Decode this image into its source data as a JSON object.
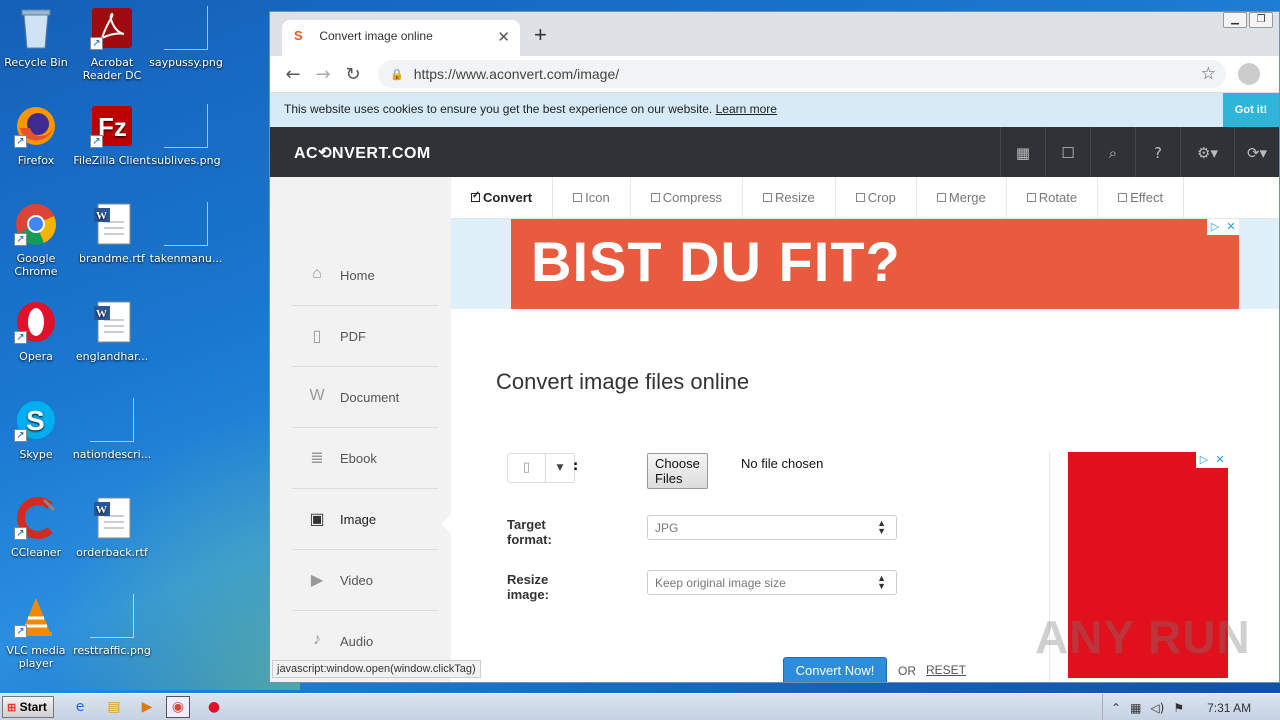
{
  "desktop": {
    "icons": [
      {
        "label": "Recycle Bin",
        "icon": "recycle-bin-icon"
      },
      {
        "label": "Acrobat Reader DC",
        "icon": "acrobat-icon"
      },
      {
        "label": "saypussy.png",
        "icon": "png-file-icon"
      },
      {
        "label": "Firefox",
        "icon": "firefox-icon"
      },
      {
        "label": "FileZilla Client",
        "icon": "filezilla-icon"
      },
      {
        "label": "sublives.png",
        "icon": "png-file-icon"
      },
      {
        "label": "Google Chrome",
        "icon": "chrome-icon"
      },
      {
        "label": "brandme.rtf",
        "icon": "word-doc-icon"
      },
      {
        "label": "takenmanu...",
        "icon": "file-icon"
      },
      {
        "label": "Opera",
        "icon": "opera-icon"
      },
      {
        "label": "englandhar...",
        "icon": "word-doc-icon"
      },
      {
        "label": "Skype",
        "icon": "skype-icon"
      },
      {
        "label": "nationdescri...",
        "icon": "file-icon"
      },
      {
        "label": "CCleaner",
        "icon": "ccleaner-icon"
      },
      {
        "label": "orderback.rtf",
        "icon": "word-doc-icon"
      },
      {
        "label": "VLC media player",
        "icon": "vlc-icon"
      },
      {
        "label": "resttraffic.png",
        "icon": "png-file-icon"
      }
    ]
  },
  "browser": {
    "tab_title": "Convert image online",
    "url": "https://www.aconvert.com/image/",
    "cookie_text": "This website uses cookies to ensure you get the best experience on our website.",
    "cookie_link": "Learn more",
    "cookie_button": "Got it!",
    "status_text": "javascript:window.open(window.clickTag)"
  },
  "site": {
    "logo": "AC⟲NVERT.COM",
    "sidebar": [
      {
        "label": "Home",
        "icon": "home-icon"
      },
      {
        "label": "PDF",
        "icon": "pdf-icon"
      },
      {
        "label": "Document",
        "icon": "document-icon"
      },
      {
        "label": "Ebook",
        "icon": "ebook-icon"
      },
      {
        "label": "Image",
        "icon": "image-icon"
      },
      {
        "label": "Video",
        "icon": "video-icon"
      },
      {
        "label": "Audio",
        "icon": "audio-icon"
      }
    ],
    "tabs": [
      "Convert",
      "Icon",
      "Compress",
      "Resize",
      "Crop",
      "Merge",
      "Rotate",
      "Effect"
    ],
    "ad_text": "BIST DU FIT?",
    "page_title": "Convert image files online",
    "form": {
      "choose_button": "Choose Files",
      "no_file": "No file chosen",
      "target_label": "Target format:",
      "target_value": "JPG",
      "resize_label": "Resize image:",
      "resize_value": "Keep original image size",
      "convert_button": "Convert Now!",
      "or_text": "OR",
      "reset": "RESET"
    }
  },
  "watermark": "ANY RUN",
  "taskbar": {
    "start": "Start",
    "clock": "7:31 AM"
  }
}
